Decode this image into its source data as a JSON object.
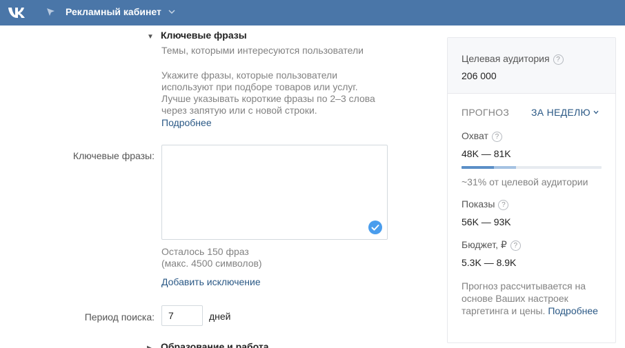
{
  "header": {
    "app_title": "Рекламный кабинет"
  },
  "keywords_section": {
    "title": "Ключевые фразы",
    "subtitle": "Темы, которыми интересуются пользователи",
    "description": "Укажите фразы, которые пользователи используют при подборе товаров или услуг. Лучше указывать короткие фразы по 2–3 слова через запятую или с новой строки.",
    "more_link": "Подробнее",
    "field_label": "Ключевые фразы:",
    "field_value": "",
    "remaining": "Осталось 150 фраз",
    "max_chars": "(макс. 4500 символов)",
    "add_exclusion": "Добавить исключение"
  },
  "search_period": {
    "label": "Период поиска:",
    "value": "7",
    "unit": "дней"
  },
  "next_section": {
    "title": "Образование и работа"
  },
  "audience_panel": {
    "target_label": "Целевая аудитория",
    "target_value": "206 000",
    "forecast_label": "ПРОГНОЗ",
    "period_select": "ЗА НЕДЕЛЮ",
    "reach_label": "Охват",
    "reach_value": "48K — 81K",
    "reach_bar": {
      "low_fraction": 0.23,
      "high_fraction": 0.39
    },
    "reach_percent": "~31% от целевой аудитории",
    "impressions_label": "Показы",
    "impressions_value": "56K — 93K",
    "budget_label": "Бюджет, ₽",
    "budget_value": "5.3K — 8.9K",
    "note_text": "Прогноз рассчитывается на основе Ваших настроек таргетинга и цены.",
    "note_link": "Подробнее"
  },
  "colors": {
    "header_bg": "#4a76a8",
    "link": "#2a5885",
    "muted": "#828282",
    "check_bg": "#4a9ded"
  },
  "icons": {
    "logo": "vk-logo",
    "nav": "flag-icon",
    "menu": "chevron-down-icon",
    "help": "question-icon",
    "valid": "checkmark-icon"
  }
}
